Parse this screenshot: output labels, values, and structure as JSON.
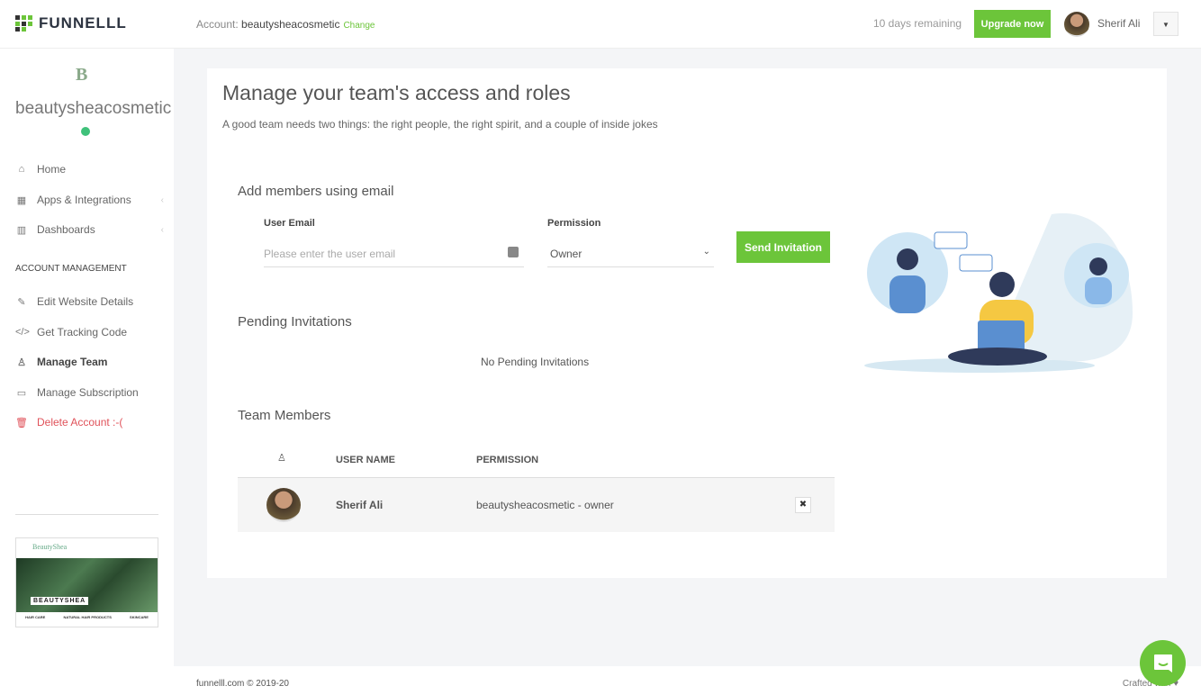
{
  "header": {
    "brand": "FUNNELLL",
    "account_label": "Account:",
    "account_name": "beautysheacosmetic",
    "change": "Change",
    "trial": "10 days remaining",
    "upgrade": "Upgrade now",
    "user": "Sherif Ali"
  },
  "sidebar": {
    "logo_letter": "B",
    "site": "beautysheacosmetic",
    "status_color": "#3fc17a",
    "items": [
      {
        "label": "Home",
        "icon": "home-icon"
      },
      {
        "label": "Apps & Integrations",
        "icon": "grid-icon"
      },
      {
        "label": "Dashboards",
        "icon": "bar-chart-icon"
      }
    ],
    "section": "ACCOUNT MANAGEMENT",
    "account_items": [
      {
        "label": "Edit Website Details",
        "icon": "pencil-icon"
      },
      {
        "label": "Get Tracking Code",
        "icon": "code-icon"
      },
      {
        "label": "Manage Team",
        "icon": "team-icon",
        "active": true
      },
      {
        "label": "Manage Subscription",
        "icon": "card-icon"
      },
      {
        "label": "Delete Account :-(",
        "icon": "trash-icon",
        "color": "#e0525a"
      }
    ],
    "preview": {
      "brand": "BEAUTYSHEA",
      "header": "BeautyShea",
      "columns": [
        "HAIR CARE",
        "NATURAL HAIR PRODUCTS",
        "SKINCARE"
      ]
    }
  },
  "main": {
    "title": "Manage your team's access and roles",
    "subtitle": "A good team needs two things: the right people, the right spirit, and a couple of inside jokes",
    "add": {
      "heading": "Add members using email",
      "email_label": "User Email",
      "email_placeholder": "Please enter the user email",
      "email_value": "",
      "permission_label": "Permission",
      "permission_value": "Owner",
      "send": "Send Invitation"
    },
    "pending": {
      "heading": "Pending Invitations",
      "empty": "No Pending Invitations"
    },
    "team": {
      "heading": "Team Members",
      "columns": [
        "USER NAME",
        "PERMISSION"
      ],
      "rows": [
        {
          "name": "Sherif Ali",
          "permission": "beautysheacosmetic - owner"
        }
      ]
    }
  },
  "footer": {
    "copyright": "funnelll.com © 2019-20",
    "crafted": "Crafted with"
  },
  "colors": {
    "accent": "#6cc53a",
    "danger": "#e0525a"
  }
}
